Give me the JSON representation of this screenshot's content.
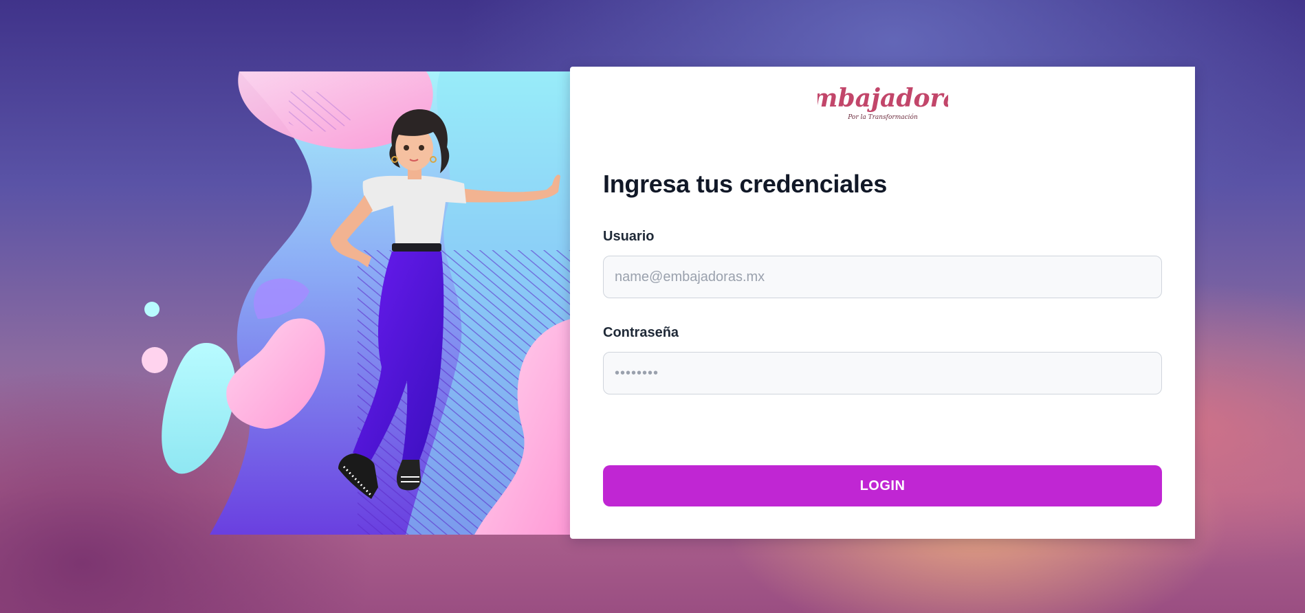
{
  "brand": {
    "logo_text": "Embajadoras",
    "logo_tagline": "Por la Transformación",
    "logo_color": "#c2466a"
  },
  "form": {
    "heading": "Ingresa tus credenciales",
    "username_label": "Usuario",
    "username_placeholder": "name@embajadoras.mx",
    "username_value": "",
    "password_label": "Contraseña",
    "password_placeholder": "••••••••",
    "password_value": "",
    "login_label": "LOGIN"
  },
  "colors": {
    "accent": "#c026d3",
    "heading": "#111827"
  },
  "illustration": {
    "icon": "woman-leaning-illustration"
  }
}
